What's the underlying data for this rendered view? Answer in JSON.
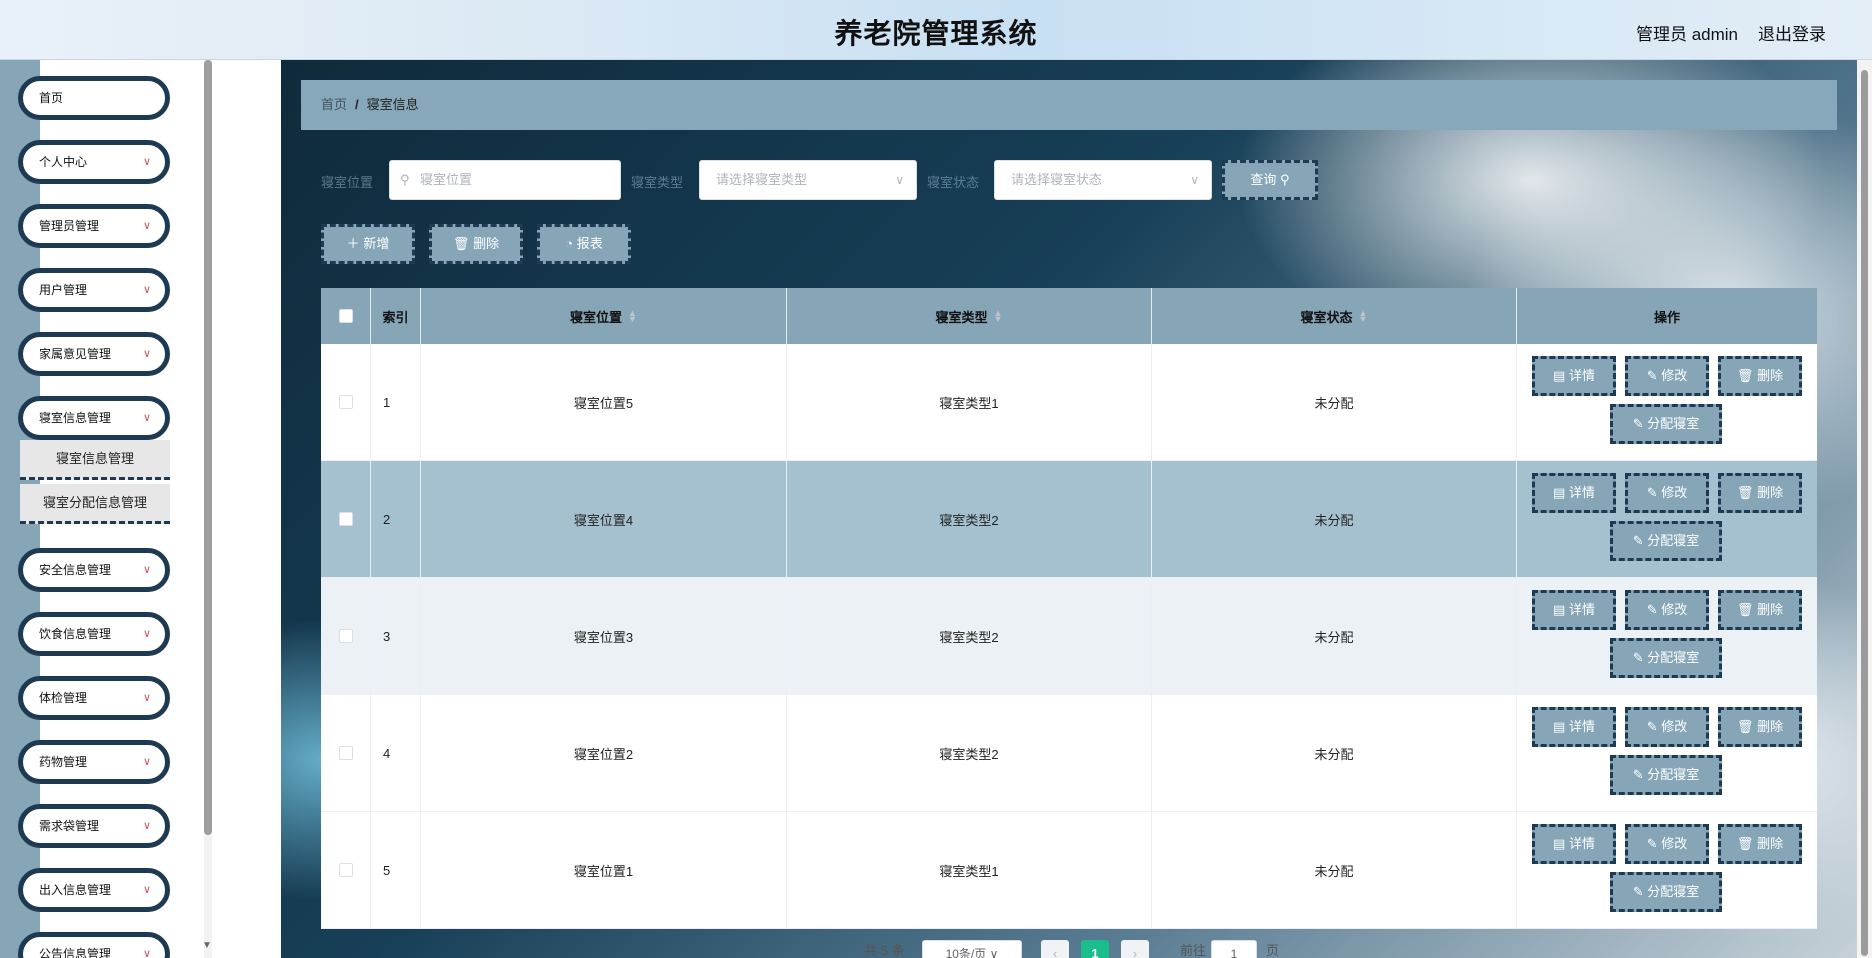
{
  "header": {
    "title": "养老院管理系统",
    "user": "管理员 admin",
    "logout": "退出登录"
  },
  "sidebar": {
    "items": [
      {
        "label": "首页",
        "expandable": false
      },
      {
        "label": "个人中心",
        "expandable": true
      },
      {
        "label": "管理员管理",
        "expandable": true
      },
      {
        "label": "用户管理",
        "expandable": true
      },
      {
        "label": "家属意见管理",
        "expandable": true
      },
      {
        "label": "寝室信息管理",
        "expandable": true
      },
      {
        "label": "安全信息管理",
        "expandable": true
      },
      {
        "label": "饮食信息管理",
        "expandable": true
      },
      {
        "label": "体检管理",
        "expandable": true
      },
      {
        "label": "药物管理",
        "expandable": true
      },
      {
        "label": "需求袋管理",
        "expandable": true
      },
      {
        "label": "出入信息管理",
        "expandable": true
      },
      {
        "label": "公告信息管理",
        "expandable": true
      }
    ],
    "sub_items": [
      "寝室信息管理",
      "寝室分配信息管理"
    ]
  },
  "breadcrumb": {
    "home": "首页",
    "separator": "/",
    "current": "寝室信息"
  },
  "search": {
    "labels": [
      "寝室位置",
      "寝室类型",
      "寝室状态"
    ],
    "location_placeholder": "寝室位置",
    "type_placeholder": "请选择寝室类型",
    "status_placeholder": "请选择寝室状态",
    "query_label": "查询"
  },
  "toolbar": {
    "add_label": "新增",
    "delete_label": "删除",
    "report_label": "报表"
  },
  "table": {
    "headers": [
      "索引",
      "寝室位置",
      "寝室类型",
      "寝室状态",
      "操作"
    ],
    "rows": [
      {
        "index": "1",
        "location": "寝室位置5",
        "type": "寝室类型1",
        "status": "未分配"
      },
      {
        "index": "2",
        "location": "寝室位置4",
        "type": "寝室类型2",
        "status": "未分配"
      },
      {
        "index": "3",
        "location": "寝室位置3",
        "type": "寝室类型2",
        "status": "未分配"
      },
      {
        "index": "4",
        "location": "寝室位置2",
        "type": "寝室类型2",
        "status": "未分配"
      },
      {
        "index": "5",
        "location": "寝室位置1",
        "type": "寝室类型1",
        "status": "未分配"
      }
    ],
    "actions": {
      "detail": "详情",
      "edit": "修改",
      "delete": "删除",
      "assign": "分配寝室"
    }
  },
  "pagination": {
    "total": "共 5 条",
    "page_size": "10条/页",
    "current_page": "1",
    "goto_prefix": "前往",
    "goto_value": "1",
    "goto_suffix": "页"
  },
  "colors": {
    "accent": "#86a6b8",
    "dark_border": "#1e3a52",
    "active_page": "#19be8c",
    "chevron": "#d24a5a"
  }
}
